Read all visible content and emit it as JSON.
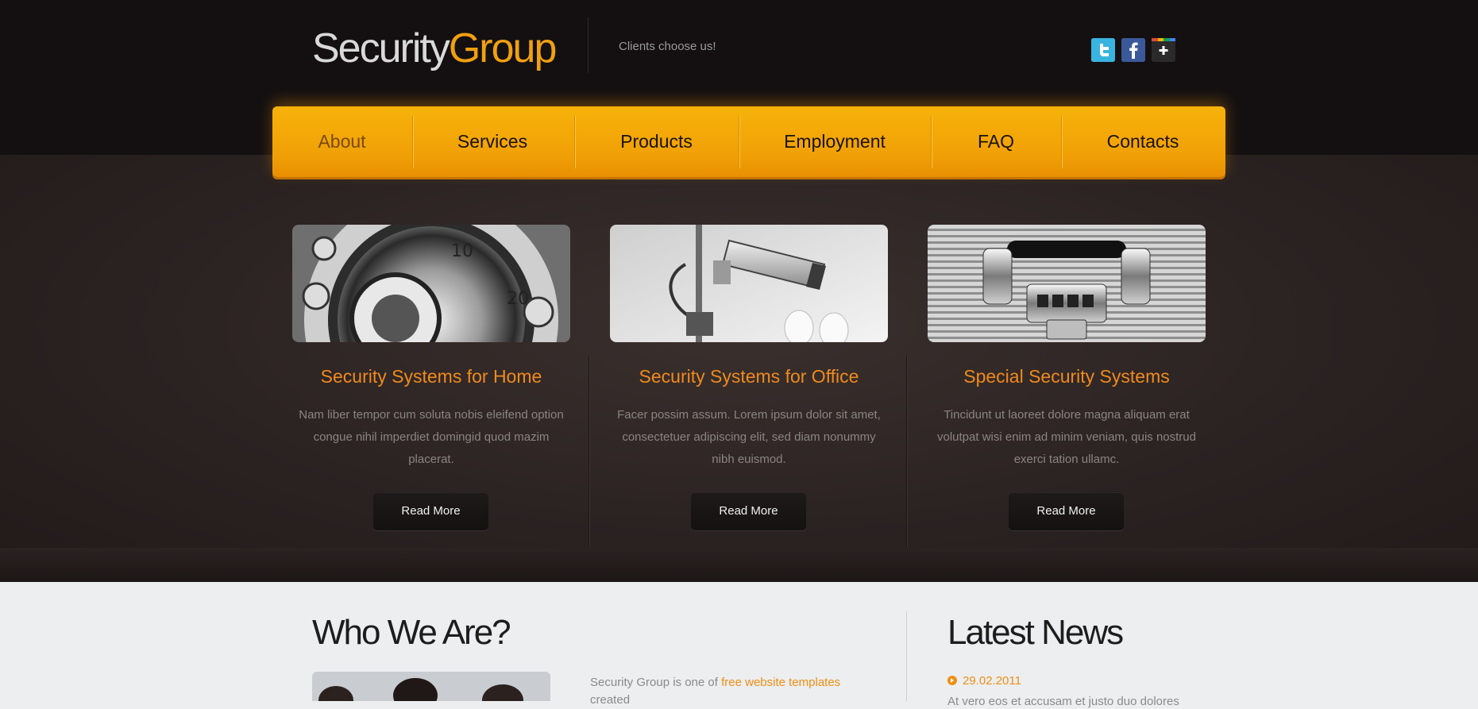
{
  "header": {
    "logo_part1": "Security",
    "logo_part2": "Group",
    "tagline": "Clients choose us!",
    "social": [
      {
        "icon": "twitter-icon",
        "color": "#3cb6e3"
      },
      {
        "icon": "facebook-icon",
        "color": "#3b5998"
      },
      {
        "icon": "google-plus-icon",
        "color": "#2a2a2a"
      }
    ]
  },
  "nav": {
    "items": [
      "About",
      "Services",
      "Products",
      "Employment",
      "FAQ",
      "Contacts"
    ],
    "active": "About"
  },
  "features": [
    {
      "image": "combination-safe-dial",
      "title": "Security Systems for Home",
      "text": "Nam liber tempor cum soluta nobis eleifend option congue nihil imperdiet domingid quod mazim placerat.",
      "button": "Read More"
    },
    {
      "image": "security-camera",
      "title": "Security Systems for Office",
      "text": "Facer possim assum. Lorem ipsum dolor sit amet, consectetuer adipiscing elit, sed diam nonummy nibh euismod.",
      "button": "Read More"
    },
    {
      "image": "metal-briefcase-lock",
      "title": "Special Security Systems",
      "text": "Tincidunt ut laoreet dolore magna aliquam erat volutpat wisi enim ad minim veniam, quis nostrud exerci tation ullamc.",
      "button": "Read More"
    }
  ],
  "about": {
    "heading": "Who We Are?",
    "text_before_link": "Security Group is one of ",
    "link": "free website templates",
    "text_after_link": " created"
  },
  "news": {
    "heading": "Latest News",
    "date": "29.02.2011",
    "snippet": "At vero eos et accusam et justo duo dolores"
  },
  "colors": {
    "accent": "#f0a010",
    "title_orange": "#f08a1c",
    "header_bg": "#141011",
    "band_bg": "#2b2322"
  }
}
